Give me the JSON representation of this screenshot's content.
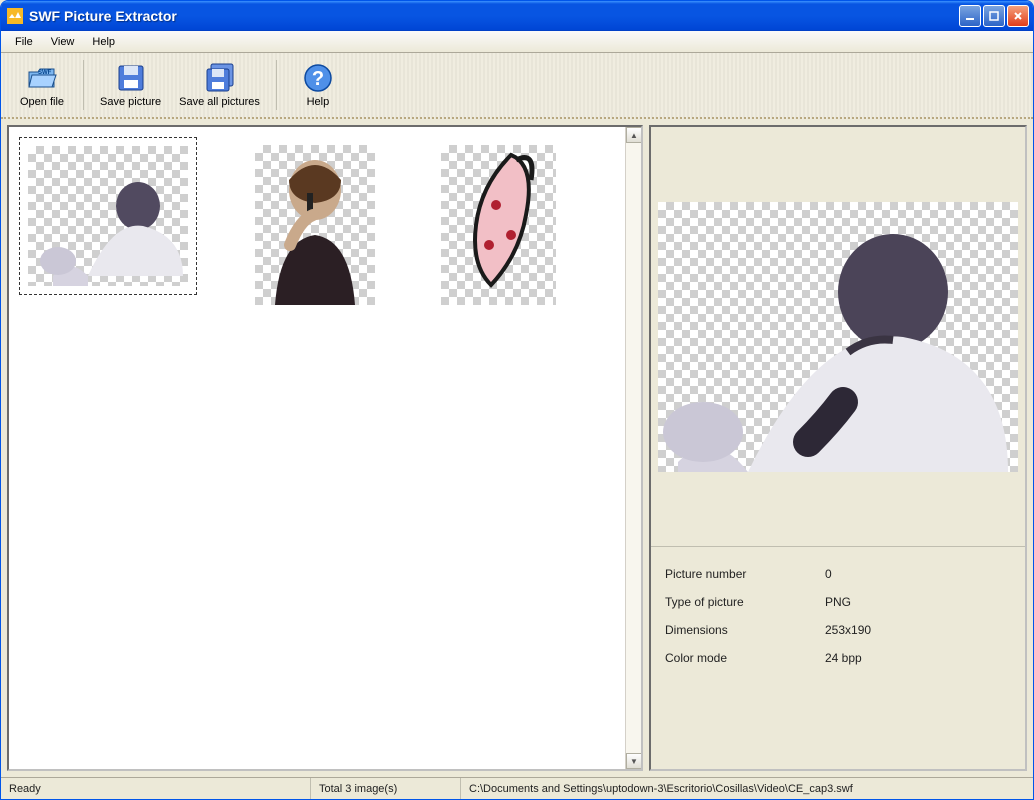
{
  "title": "SWF Picture Extractor",
  "menu": {
    "file": "File",
    "view": "View",
    "help": "Help"
  },
  "toolbar": {
    "open": "Open file",
    "save": "Save picture",
    "saveAll": "Save all pictures",
    "help": "Help"
  },
  "thumbs": {
    "count": 3
  },
  "preview": {
    "labels": {
      "num": "Picture number",
      "type": "Type of picture",
      "dim": "Dimensions",
      "mode": "Color mode"
    },
    "values": {
      "num": "0",
      "type": "PNG",
      "dim": "253x190",
      "mode": "24 bpp"
    }
  },
  "status": {
    "ready": "Ready",
    "total": "Total 3 image(s)",
    "path": "C:\\Documents and Settings\\uptodown-3\\Escritorio\\Cosillas\\Video\\CE_cap3.swf"
  }
}
